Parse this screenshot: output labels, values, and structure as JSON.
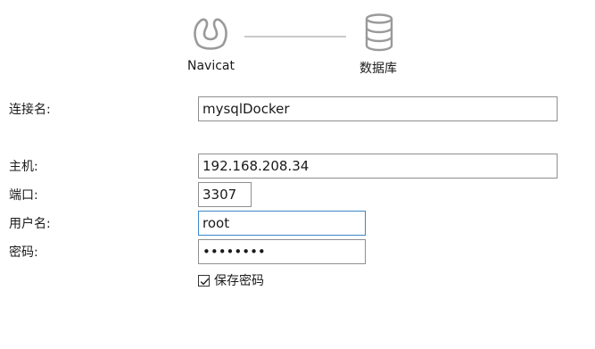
{
  "diagram": {
    "source_label": "Navicat",
    "target_label": "数据库"
  },
  "form": {
    "connection_name": {
      "label": "连接名:",
      "value": "mysqlDocker"
    },
    "host": {
      "label": "主机:",
      "value": "192.168.208.34"
    },
    "port": {
      "label": "端口:",
      "value": "3307"
    },
    "username": {
      "label": "用户名:",
      "value": "root"
    },
    "password": {
      "label": "密码:",
      "value": "12345678"
    },
    "save_password": {
      "label": "保存密码",
      "checked": true
    }
  },
  "colors": {
    "focus_border": "#3c87c9",
    "icon_gray": "#9a9a9a",
    "connector_line": "#c9c9c9"
  }
}
